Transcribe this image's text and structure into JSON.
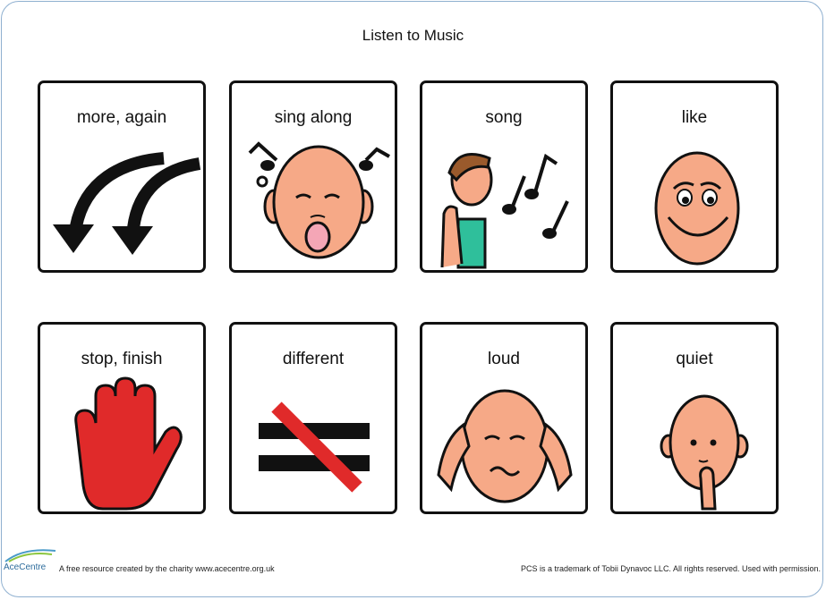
{
  "title": "Listen to Music",
  "cards": [
    {
      "label": "more, again",
      "icon": "curved-arrows-icon"
    },
    {
      "label": "sing along",
      "icon": "singing-face-icon"
    },
    {
      "label": "song",
      "icon": "boy-listening-icon"
    },
    {
      "label": "like",
      "icon": "smiling-face-icon"
    },
    {
      "label": "stop, finish",
      "icon": "red-hand-icon"
    },
    {
      "label": "different",
      "icon": "not-equal-icon"
    },
    {
      "label": "loud",
      "icon": "covering-ears-icon"
    },
    {
      "label": "quiet",
      "icon": "shush-face-icon"
    }
  ],
  "footer": {
    "logo_text": "AceCentre",
    "left": "A free resource created by the charity www.acecentre.org.uk",
    "right": "PCS is a trademark of Tobii Dynavoc LLC.  All rights reserved.  Used with permission."
  },
  "colors": {
    "skin": "#f6a987",
    "border": "#111111",
    "frame": "#8fb0d0",
    "red": "#e02a2a",
    "teal": "#2fbf9b"
  }
}
